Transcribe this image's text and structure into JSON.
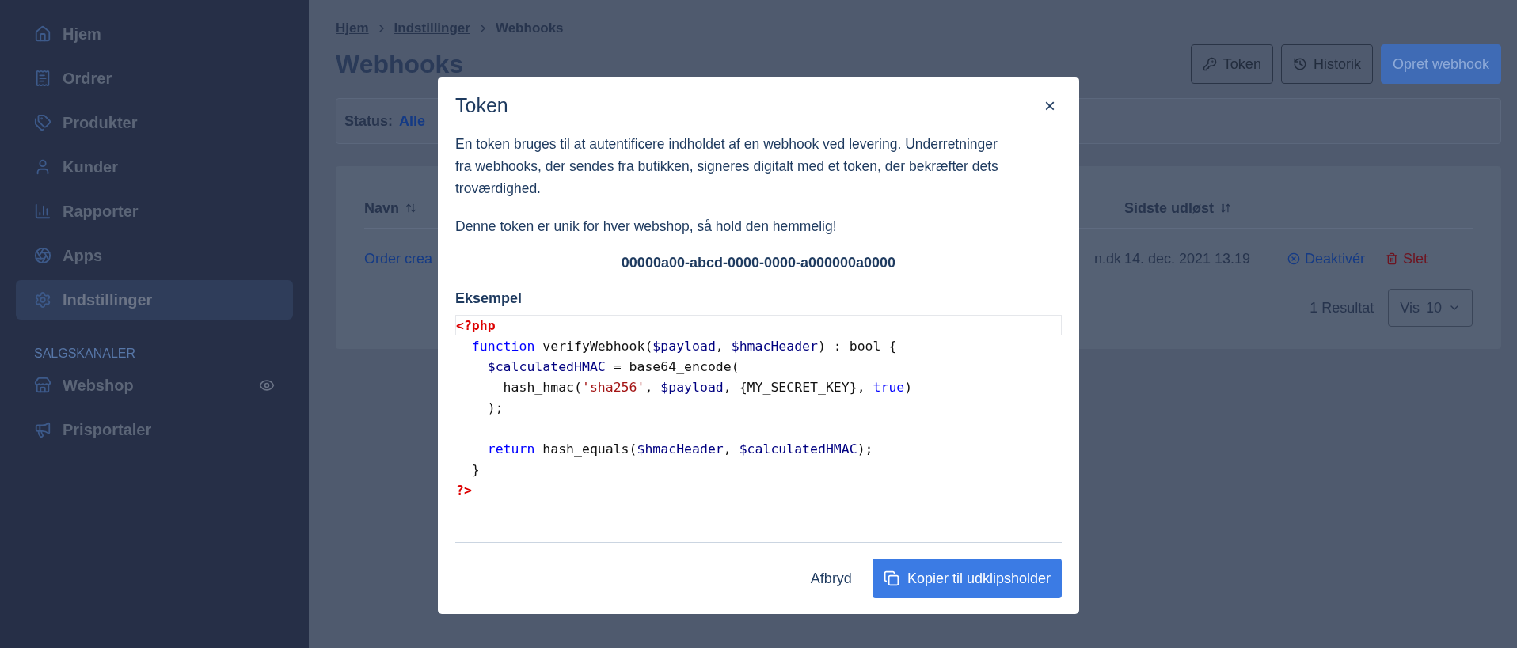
{
  "sidebar": {
    "items": [
      {
        "label": "Hjem",
        "selected": false
      },
      {
        "label": "Ordrer",
        "selected": false
      },
      {
        "label": "Produkter",
        "selected": false
      },
      {
        "label": "Kunder",
        "selected": false
      },
      {
        "label": "Rapporter",
        "selected": false
      },
      {
        "label": "Apps",
        "selected": false
      },
      {
        "label": "Indstillinger",
        "selected": true
      }
    ],
    "section_title": "SALGSKANALER",
    "channels": [
      {
        "label": "Webshop",
        "visible": true
      },
      {
        "label": "Prisportaler",
        "visible": false
      }
    ]
  },
  "breadcrumb": [
    "Hjem",
    "Indstillinger",
    "Webhooks"
  ],
  "page_title": "Webhooks",
  "header_buttons": [
    {
      "label": "Token",
      "kind": "outline"
    },
    {
      "label": "Historik",
      "kind": "outline"
    },
    {
      "label": "Opret webhook",
      "kind": "primary"
    }
  ],
  "filter": {
    "label": "Status:",
    "value": "Alle"
  },
  "table": {
    "columns": [
      "Navn",
      "Sidste udløst"
    ],
    "rows": [
      {
        "name": "Order crea",
        "column_2": "n.dk",
        "last_fired": "14. dec. 2021 13.19",
        "actions": [
          {
            "label": "Deaktivér",
            "kind": "deactivate"
          },
          {
            "label": "Slet",
            "kind": "delete"
          }
        ]
      }
    ],
    "result_count": "1 Resultat",
    "page_size_label": "Vis",
    "page_size": "10"
  },
  "modal": {
    "title": "Token",
    "close": "×",
    "paragraphs": [
      "En token bruges til at autentificere indholdet af en webhook ved levering. Underretninger fra webhooks, der sendes fra butikken, signeres digitalt med et token, der bekræfter dets troværdighed.",
      "Denne token er unik for hver webshop, så hold den hemmelig!"
    ],
    "token": "00000a00-abcd-0000-0000-a000000a0000",
    "example_label": "Eksempel",
    "code_lines": [
      {
        "active": true,
        "tokens": [
          {
            "text": "<?php",
            "kind": "tag"
          }
        ]
      },
      {
        "active": false,
        "tokens": [
          {
            "text": "  function",
            "kind": "keyword"
          },
          {
            "text": " verifyWebhook(",
            "kind": "plain"
          },
          {
            "text": "$payload",
            "kind": "variable"
          },
          {
            "text": ", ",
            "kind": "plain"
          },
          {
            "text": "$hmacHeader",
            "kind": "variable"
          },
          {
            "text": ") : bool {",
            "kind": "plain"
          }
        ]
      },
      {
        "active": false,
        "tokens": [
          {
            "text": "    $calculatedHMAC",
            "kind": "variable"
          },
          {
            "text": " = base64_encode(",
            "kind": "plain"
          }
        ]
      },
      {
        "active": false,
        "tokens": [
          {
            "text": "      hash_hmac(",
            "kind": "plain"
          },
          {
            "text": "'sha256'",
            "kind": "string"
          },
          {
            "text": ", ",
            "kind": "plain"
          },
          {
            "text": "$payload",
            "kind": "variable"
          },
          {
            "text": ", {MY_SECRET_KEY}, ",
            "kind": "plain"
          },
          {
            "text": "true",
            "kind": "keyword"
          },
          {
            "text": ")",
            "kind": "plain"
          }
        ]
      },
      {
        "active": false,
        "tokens": [
          {
            "text": "    );",
            "kind": "plain"
          }
        ]
      },
      {
        "active": false,
        "blank_before": true,
        "tokens": [
          {
            "text": "    return",
            "kind": "keyword"
          },
          {
            "text": " hash_equals(",
            "kind": "plain"
          },
          {
            "text": "$hmacHeader",
            "kind": "variable"
          },
          {
            "text": ", ",
            "kind": "plain"
          },
          {
            "text": "$calculatedHMAC",
            "kind": "variable"
          },
          {
            "text": ");",
            "kind": "plain"
          }
        ]
      },
      {
        "active": false,
        "tokens": [
          {
            "text": "  }",
            "kind": "plain"
          }
        ]
      },
      {
        "active": false,
        "tokens": [
          {
            "text": "?>",
            "kind": "tag"
          }
        ]
      }
    ],
    "cancel": "Afbryd",
    "copy": "Kopier til udklipsholder"
  }
}
